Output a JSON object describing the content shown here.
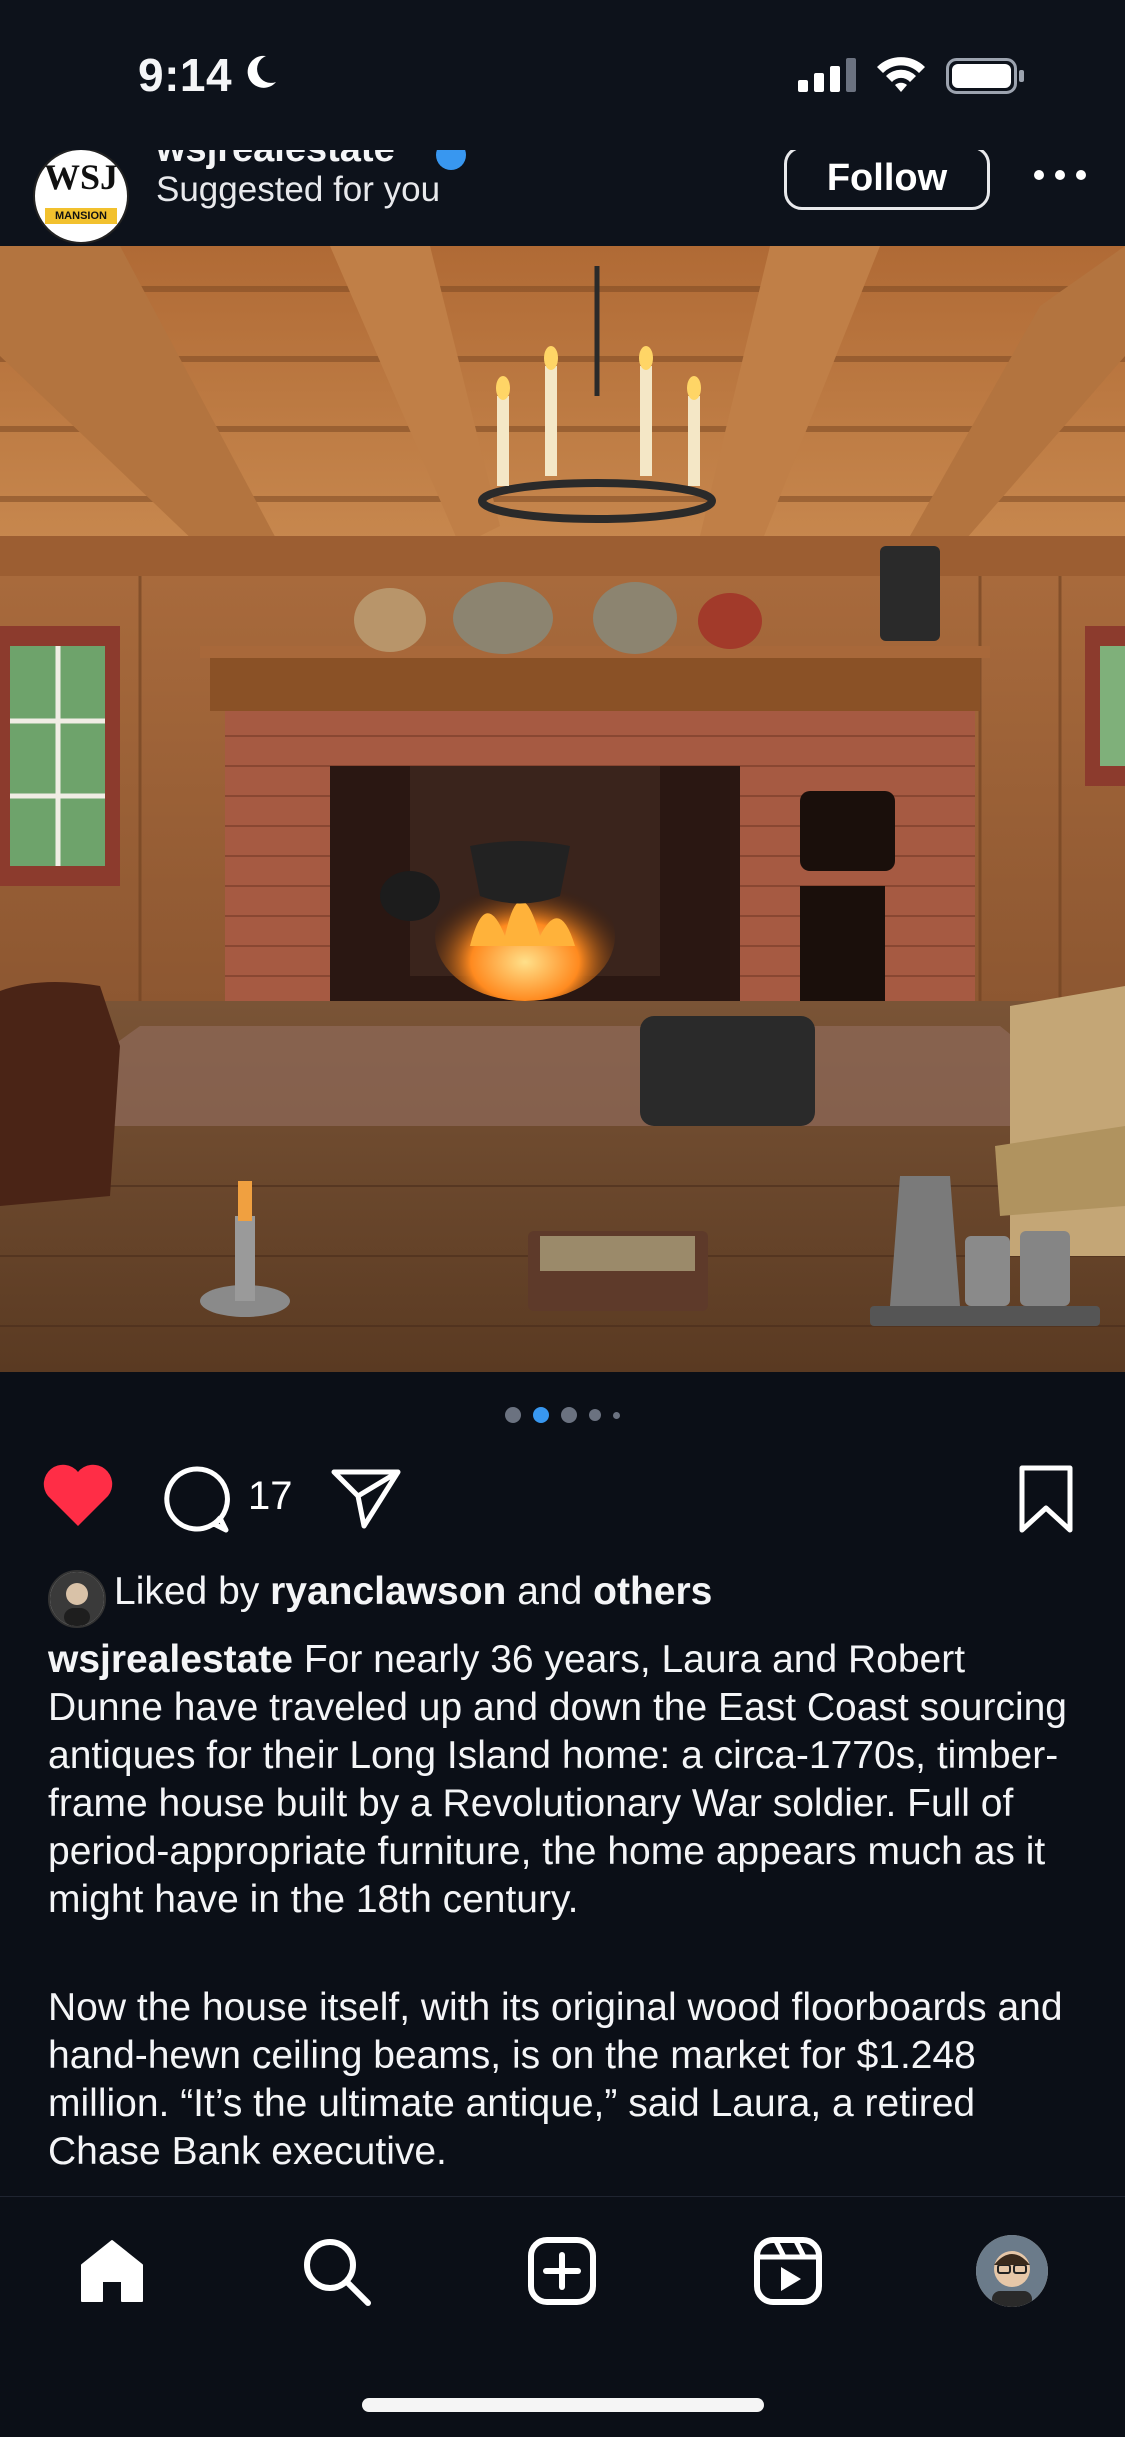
{
  "status_bar": {
    "time": "9:14"
  },
  "post": {
    "username": "wsjrealestate",
    "subtitle": "Suggested for you",
    "follow_label": "Follow",
    "avatar_text": "WSJ",
    "avatar_band": "MANSION",
    "carousel": {
      "count": 5,
      "active_index": 1
    },
    "liked": true,
    "comment_count": "17",
    "liked_by": {
      "prefix": "Liked by",
      "user": "ryanclawson",
      "and": "and",
      "others": "others"
    },
    "caption_user": "wsjrealestate",
    "caption_p1": "For nearly 36 years, Laura and Robert Dunne have traveled up and down the East Coast sourcing antiques for their Long Island home: a circa-1770s, timber-frame house built by a Revolutionary War soldier. Full of period-appropriate furniture, the home appears much as it might have in the 18th century.",
    "caption_p2": "Now the house itself, with its original wood floorboards and hand-hewn ceiling beams, is on the market for $1.248 million. “It’s the ultimate antique,” said Laura, a retired Chase Bank executive."
  },
  "nav": {
    "items": [
      "home-icon",
      "search-icon",
      "create-icon",
      "reels-icon",
      "profile-avatar"
    ]
  },
  "colors": {
    "background": "#0b0f17",
    "accent_blue": "#3897f0",
    "like_red": "#ff2d46"
  }
}
